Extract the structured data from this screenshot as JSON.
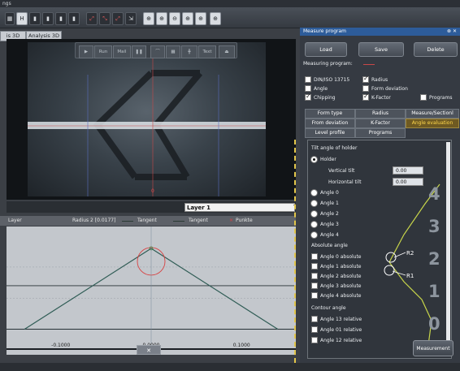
{
  "window": {
    "title": "ngs"
  },
  "tabs": [
    "is 3D",
    "Analysis 3D"
  ],
  "video_toolbar": {
    "run": "Run",
    "mail": "Mail",
    "text": "Text"
  },
  "layer_select": {
    "value": "Layer 1"
  },
  "legend": {
    "layer": "Layer",
    "radius": "Radius 2 [0.0177]",
    "tangent1": "Tangent",
    "tangent2": "Tangent",
    "points": "Punkte"
  },
  "plot": {
    "ticks": [
      "-0.1000",
      "0.0000",
      "0.1000"
    ],
    "video_marker": "0",
    "close": "✕"
  },
  "chart_data": {
    "type": "line",
    "title": "",
    "series": [
      {
        "name": "Tangent",
        "points": [
          [
            -0.14,
            0.0
          ],
          [
            0.0,
            0.26
          ]
        ]
      },
      {
        "name": "Tangent",
        "points": [
          [
            0.0,
            0.26
          ],
          [
            0.14,
            0.0
          ]
        ]
      }
    ],
    "circle_radius": 0.0177,
    "x_ticks": [
      "-0.1000",
      "0.0000",
      "0.1000"
    ],
    "xlabel": "",
    "ylabel": "",
    "legend": [
      "Layer",
      "Radius 2 [0.0177]",
      "Tangent",
      "Tangent",
      "Punkte"
    ]
  },
  "panel": {
    "title": "Measure program",
    "close": "⊗ ✕",
    "load": "Load",
    "save": "Save",
    "delete": "Delete",
    "measuring_program": "Measuring program:",
    "checks": {
      "din": "DIN/ISO 13715",
      "radius": "Radius",
      "angle": "Angle",
      "form_deviation": "Form deviation",
      "chipping": "Chipping",
      "kfactor": "K-Factor",
      "programs": "Programs"
    },
    "tabs": {
      "form_type": "Form type",
      "radius": "Radius",
      "measure_sectional": "Measure/Sectionl",
      "from_deviation": "From deviation",
      "kfactor": "K-Factor",
      "angle_evaluation": "Angle evaluation",
      "level_profile": "Level profile",
      "programs": "Programs"
    },
    "sub": {
      "tilt_header": "Tilt angle of holder",
      "holder": "Holder",
      "vertical_tilt": "Vertical tilt",
      "vertical_value": "0.00",
      "horizontal_tilt": "Horizontal tilt",
      "horizontal_value": "0.00",
      "angles": [
        "Angle 0",
        "Angle 1",
        "Angle 2",
        "Angle 3",
        "Angle 4"
      ],
      "absolute_header": "Absolute angle",
      "absolute": [
        "Angle 0 absolute",
        "Angle 1 absolute",
        "Angle 2 absolute",
        "Angle 3 absolute",
        "Angle 4 absolute"
      ],
      "contour_header": "Contour angle",
      "contour": [
        "Angle 13 relative",
        "Angle 01 relative",
        "Angle 12 relative"
      ],
      "digits": [
        "4",
        "3",
        "2",
        "1",
        "0"
      ],
      "r2": "R2",
      "r1": "R1"
    },
    "measurement": "Measurement"
  }
}
